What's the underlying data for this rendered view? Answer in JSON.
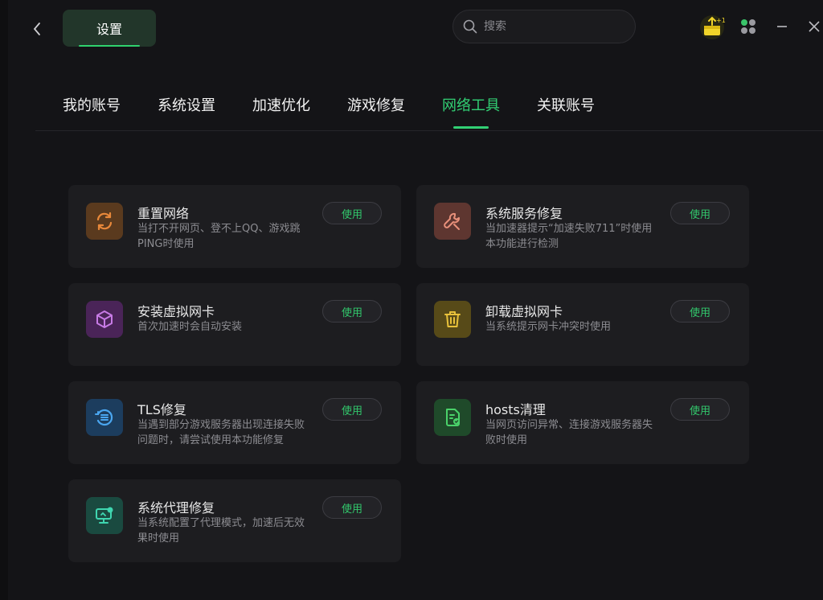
{
  "header": {
    "title": "设置",
    "search_placeholder": "搜索"
  },
  "tabs": [
    {
      "label": "我的账号",
      "active": false
    },
    {
      "label": "系统设置",
      "active": false
    },
    {
      "label": "加速优化",
      "active": false
    },
    {
      "label": "游戏修复",
      "active": false
    },
    {
      "label": "网络工具",
      "active": true
    },
    {
      "label": "关联账号",
      "active": false
    }
  ],
  "tools": [
    {
      "name": "重置网络",
      "desc": "当打不开网页、登不上QQ、游戏跳PING时使用",
      "button": "使用",
      "icon": "refresh-icon",
      "color": "#e8883a"
    },
    {
      "name": "系统服务修复",
      "desc": "当加速器提示“加速失败711”时使用本功能进行检测",
      "button": "使用",
      "icon": "wrench-icon",
      "color": "#e8907a"
    },
    {
      "name": "安装虚拟网卡",
      "desc": "首次加速时会自动安装",
      "button": "使用",
      "icon": "cube-icon",
      "color": "#c87be6"
    },
    {
      "name": "卸载虚拟网卡",
      "desc": "当系统提示网卡冲突时使用",
      "button": "使用",
      "icon": "trash-icon",
      "color": "#e8c13a"
    },
    {
      "name": "TLS修复",
      "desc": "当遇到部分游戏服务器出现连接失败问题时，请尝试使用本功能修复",
      "button": "使用",
      "icon": "tls-repair-icon",
      "color": "#4aa6f0"
    },
    {
      "name": "hosts清理",
      "desc": "当网页访问异常、连接游戏服务器失败时使用",
      "button": "使用",
      "icon": "document-clean-icon",
      "color": "#4ad26a"
    },
    {
      "name": "系统代理修复",
      "desc": "当系统配置了代理模式，加速后无效果时使用",
      "button": "使用",
      "icon": "monitor-proxy-icon",
      "color": "#3fd6b0"
    }
  ],
  "colors": {
    "accent": "#32d074",
    "background": "#141417",
    "card": "#1d1d20"
  }
}
